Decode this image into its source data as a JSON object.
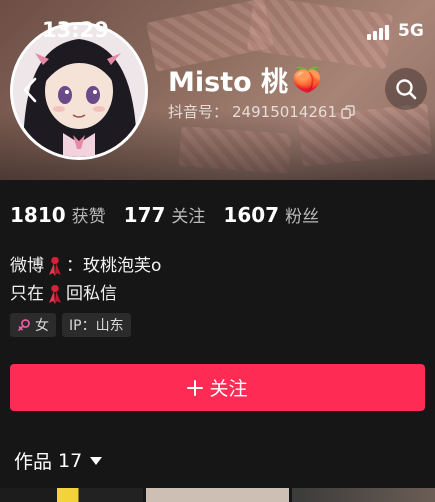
{
  "status_bar": {
    "time": "13:29",
    "network": "5G"
  },
  "profile": {
    "username": "Misto 桃",
    "username_emoji": "🍑",
    "id_label": "抖音号：",
    "id_value": "24915014261"
  },
  "stats": [
    {
      "num": "1810",
      "label": "获赞"
    },
    {
      "num": "177",
      "label": "关注"
    },
    {
      "num": "1607",
      "label": "粉丝"
    }
  ],
  "bio": {
    "line1_prefix": "微博",
    "line1_suffix": "：玫桃泡芙o",
    "line2_prefix": "只在",
    "line2_suffix": "回私信"
  },
  "tags": {
    "gender": "女",
    "ip": "IP：山东"
  },
  "follow_button": {
    "label": "关注"
  },
  "works_tab": {
    "label": "作品",
    "count": "17"
  },
  "colors": {
    "accent": "#fe2c55",
    "background": "#161616",
    "tag_bg": "#2b2b2b",
    "gender_icon": "#f25fa8"
  }
}
